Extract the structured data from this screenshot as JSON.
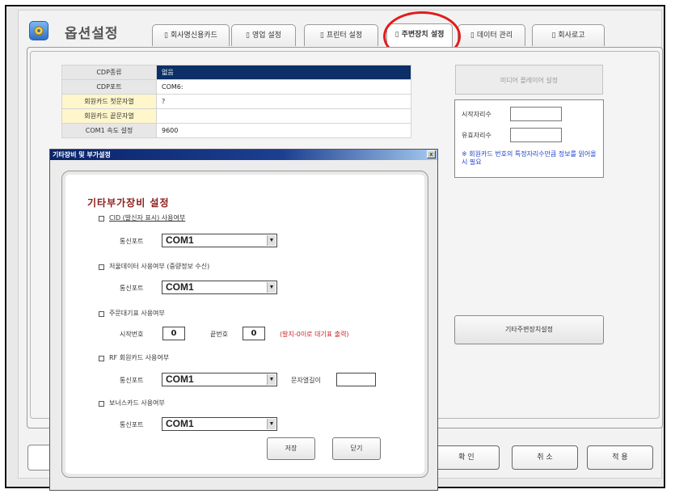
{
  "window": {
    "title": "옵션설정"
  },
  "tabs": [
    {
      "label": "회사명신용카드"
    },
    {
      "label": "영업 설정"
    },
    {
      "label": "프린터 설정"
    },
    {
      "label": "주변장치 설정"
    },
    {
      "label": "데이터 관리"
    },
    {
      "label": "회사로고"
    }
  ],
  "active_tab": "주변장치 설정",
  "settings": [
    {
      "label": "CDP종류",
      "value": "없음"
    },
    {
      "label": "CDP포트",
      "value": "COM6:"
    },
    {
      "label": "회원카드 첫문자열",
      "value": "?"
    },
    {
      "label": "회원카드 끝문자열",
      "value": ""
    },
    {
      "label": "COM1 속도 설정",
      "value": "9600"
    }
  ],
  "right": {
    "media_button": "미디어 플레이어 설정",
    "start_digit_label": "시작자리수",
    "valid_digit_label": "유효자리수",
    "digit_note": "※ 회원카드 번호의 특정자리수만큼 정보를 읽어올 시 필요",
    "etc_button": "기타주변장치설정"
  },
  "bottom": {
    "ok": "확 인",
    "cancel": "취 소",
    "apply": "적 용"
  },
  "dialog": {
    "title": "기타장비 및 부가설정",
    "close": "x",
    "section_title": "기타부가장비 설정",
    "cid": {
      "label": "CID (발신자 표시) 사용여부",
      "port_label": "통신포트",
      "port": "COM1"
    },
    "customer_display": {
      "label": "저울데이터 사용여부 (중량정보 수신)",
      "port_label": "통신포트",
      "port": "COM1"
    },
    "order_ticket": {
      "label": "주문대기표 사용여부",
      "start_label": "시작번호",
      "start": "0",
      "end_label": "끝번호",
      "end": "0",
      "note": "(발지-0이로 대기표 출력)"
    },
    "rf_card": {
      "label": "RF 회원카드 사용여부",
      "port_label": "통신포트",
      "port": "COM1",
      "length_label": "문자열길이",
      "length": ""
    },
    "bonus_card": {
      "label": "보너스카드 사용여부",
      "port_label": "통신포트",
      "port": "COM1"
    },
    "save_button": "저장",
    "close_button": "닫기"
  },
  "colors": {
    "selected_row": "#0b2f66",
    "highlight_circle": "#e21b1b",
    "note_blue": "#2244cc",
    "note_red": "#cc2222",
    "section_title": "#8b1a1a"
  },
  "icons": {
    "app": "gear-icon",
    "dropdown": "chevron-down-icon"
  }
}
